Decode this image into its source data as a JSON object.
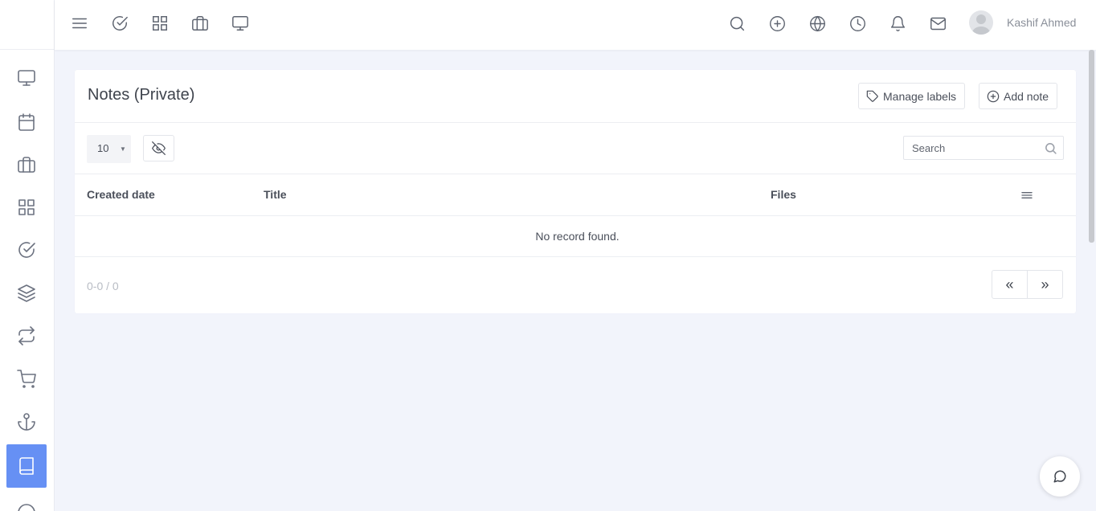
{
  "topbar": {
    "left_icons": [
      "menu-icon",
      "check-circle-icon",
      "grid-icon",
      "briefcase-icon",
      "monitor-icon"
    ],
    "right_icons": [
      "search-icon",
      "plus-circle-icon",
      "globe-icon",
      "clock-icon",
      "bell-icon",
      "mail-icon"
    ],
    "user_name": "Kashif Ahmed"
  },
  "sidebar": {
    "items": [
      "monitor-icon",
      "calendar-icon",
      "briefcase-icon",
      "grid-icon",
      "check-circle-icon",
      "layers-icon",
      "repeat-icon",
      "cart-icon",
      "anchor-icon",
      "book-icon",
      "help-icon"
    ],
    "active": "book-icon",
    "accent": "#6690f4"
  },
  "page": {
    "title": "Notes (Private)",
    "manage_labels": "Manage labels",
    "add_note": "Add note"
  },
  "table": {
    "page_size": "10",
    "search_placeholder": "Search",
    "columns": [
      "Created date",
      "Title",
      "Files"
    ],
    "empty_message": "No record found.",
    "pager_info": "0-0 / 0",
    "prev": "«",
    "next": "»"
  }
}
